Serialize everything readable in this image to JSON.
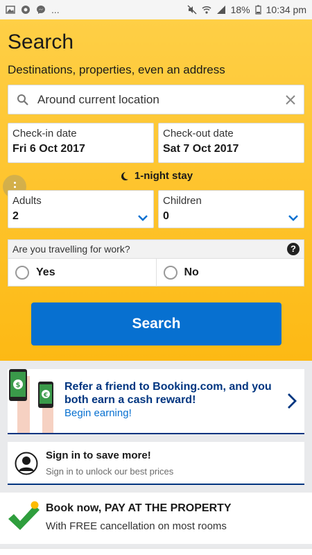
{
  "status_bar": {
    "battery": "18%",
    "time": "10:34 pm",
    "overflow": "..."
  },
  "search": {
    "title": "Search",
    "subtitle": "Destinations, properties, even an address",
    "destination_value": "Around current location",
    "checkin_label": "Check-in date",
    "checkin_value": "Fri 6 Oct 2017",
    "checkout_label": "Check-out date",
    "checkout_value": "Sat 7 Oct 2017",
    "stay_length": "1-night stay",
    "adults_label": "Adults",
    "adults_value": "2",
    "children_label": "Children",
    "children_value": "0",
    "work_question": "Are you travelling for work?",
    "work_yes": "Yes",
    "work_no": "No",
    "search_button": "Search"
  },
  "refer": {
    "title": "Refer a friend to Booking.com, and you both earn a cash reward!",
    "link": "Begin earning!"
  },
  "signin": {
    "title": "Sign in to save more!",
    "subtitle": "Sign in to unlock our best prices"
  },
  "booknow": {
    "title": "Book now, PAY AT THE PROPERTY",
    "subtitle": "With FREE cancellation on most rooms"
  },
  "colors": {
    "brand_yellow": "#febb02",
    "primary_blue": "#0770d0",
    "navy": "#003580",
    "check_green": "#2f9e3d"
  }
}
